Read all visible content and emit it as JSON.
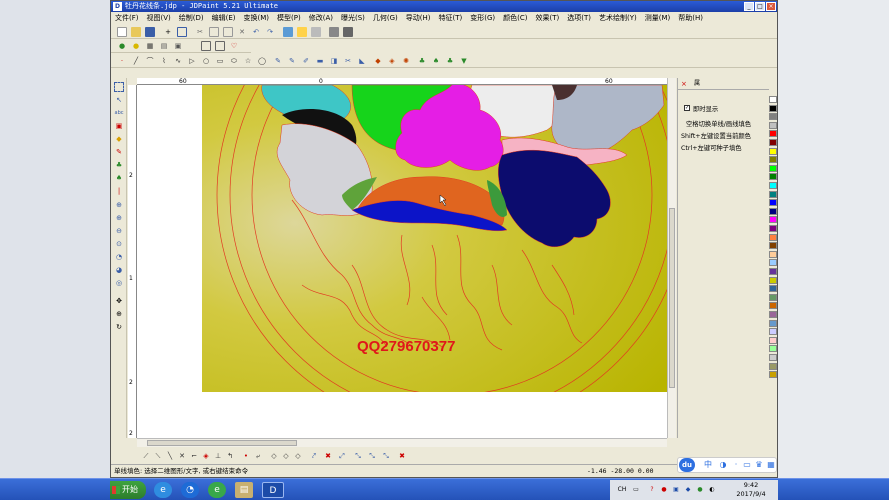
{
  "window": {
    "title": "牡丹花线条.jdp - JDPaint 5.21 Ultimate",
    "title_icon": "D",
    "min": "_",
    "max": "□",
    "close": "×"
  },
  "menu": [
    "文件(F)",
    "视图(V)",
    "绘制(D)",
    "编辑(E)",
    "变换(M)",
    "模型(P)",
    "修改(A)",
    "曝光(S)",
    "几何(G)",
    "导动(H)",
    "特征(T)",
    "变形(G)",
    "颜色(C)",
    "效果(T)",
    "选项(T)",
    "艺术绘制(Y)",
    "测量(M)",
    "帮助(H)"
  ],
  "rulers": {
    "top_ticks": [
      "60",
      "0",
      "60"
    ],
    "left_ticks": [
      "2",
      "1",
      "2",
      "2"
    ]
  },
  "canvas": {
    "watermark": "QQ279670377"
  },
  "panel": {
    "close_icon": "×",
    "tab_label": "属",
    "check_mark": "✓",
    "realtime": "即时显示",
    "hint1": "空格切换单线/画线填色",
    "hint2": "Shift+左键设置当前颜色",
    "hint3": "Ctrl+左键可种子填色"
  },
  "palette": [
    "#ffffff",
    "#000000",
    "#808080",
    "#c0c0c0",
    "#ff0000",
    "#800000",
    "#ffff00",
    "#808000",
    "#00ff00",
    "#008000",
    "#00ffff",
    "#008080",
    "#0000ff",
    "#000080",
    "#ff00ff",
    "#800080",
    "#ff8040",
    "#804000",
    "#ffcc99",
    "#99ccff",
    "#663399",
    "#cccc00",
    "#336699",
    "#669966",
    "#cc6600",
    "#996699",
    "#6699cc",
    "#ccccff",
    "#ffcccc",
    "#99ff99",
    "#cccccc",
    "#999966",
    "#c8a000"
  ],
  "status": {
    "left": "单线填色: 选择二维图形/文字, 或右键结束命令",
    "coords": "-1.46 -28.00 0.00"
  },
  "taskbar": {
    "start": "开始",
    "clock_time": "9:42",
    "clock_date": "2017/9/4",
    "ime_logo": "du",
    "ime_text": "中",
    "lang": "CH"
  }
}
